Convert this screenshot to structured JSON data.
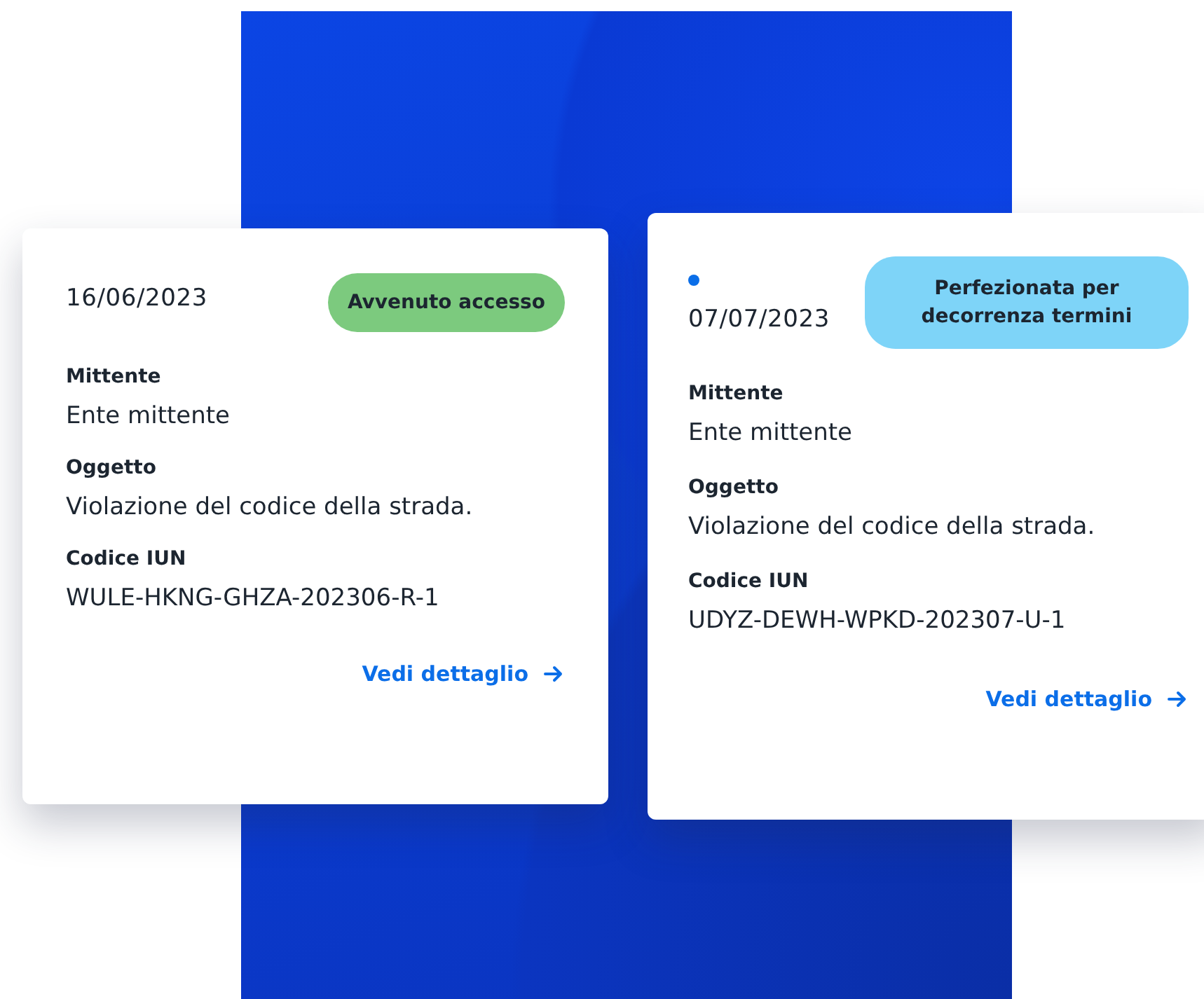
{
  "cards": [
    {
      "unread": false,
      "date": "16/06/2023",
      "status": {
        "label": "Avvenuto accesso",
        "color": "#7cca7e"
      },
      "fields": [
        {
          "label": "Mittente",
          "value": "Ente mittente"
        },
        {
          "label": "Oggetto",
          "value": "Violazione del codice della strada."
        },
        {
          "label": "Codice IUN",
          "value": "WULE-HKNG-GHZA-202306-R-1"
        }
      ],
      "link": "Vedi dettaglio"
    },
    {
      "unread": true,
      "date": "07/07/2023",
      "status": {
        "label": "Perfezionata per decorrenza termini",
        "color": "#7ed4f8"
      },
      "fields": [
        {
          "label": "Mittente",
          "value": "Ente mittente"
        },
        {
          "label": "Oggetto",
          "value": "Violazione del codice della strada."
        },
        {
          "label": "Codice IUN",
          "value": "UDYZ-DEWH-WPKD-202307-U-1"
        }
      ],
      "link": "Vedi dettaglio"
    }
  ]
}
